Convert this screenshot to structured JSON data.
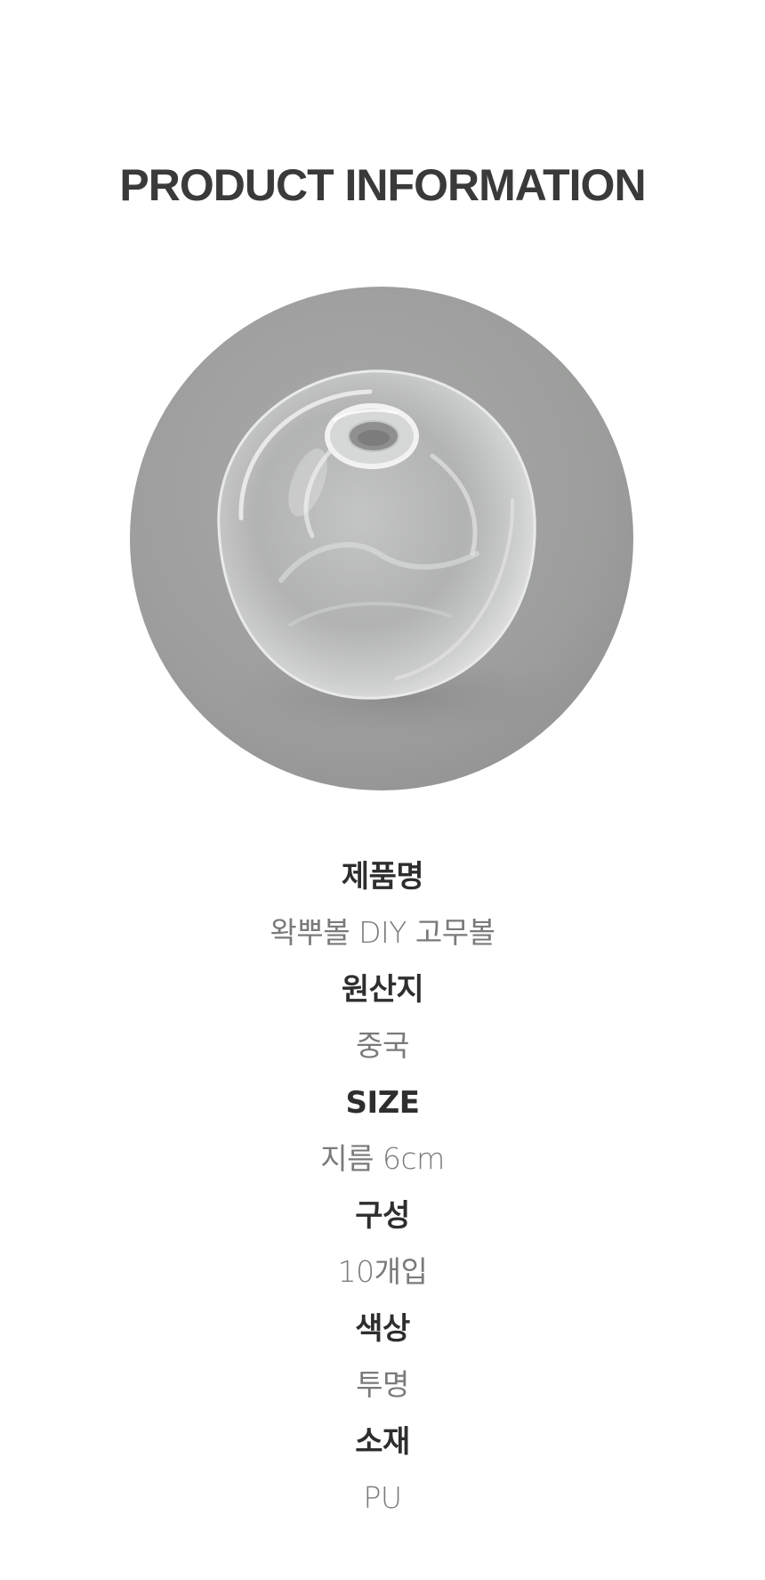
{
  "header": {
    "title": "PRODUCT INFORMATION"
  },
  "product_image": {
    "subject": "clear-ball",
    "background_color": "#9c9d9c"
  },
  "info": [
    {
      "label": "제품명",
      "value": "왁뿌볼 DIY 고무볼"
    },
    {
      "label": "원산지",
      "value": "중국"
    },
    {
      "label": "SIZE",
      "value": "지름 6cm"
    },
    {
      "label": "구성",
      "value": "10개입"
    },
    {
      "label": "색상",
      "value": "투명"
    },
    {
      "label": "소재",
      "value": "PU"
    }
  ]
}
